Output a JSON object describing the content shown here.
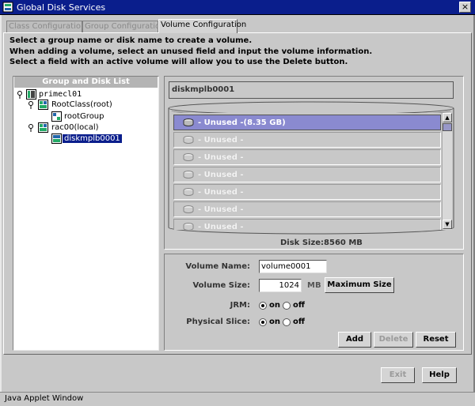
{
  "window": {
    "title": "Global Disk Services",
    "close": "×"
  },
  "tabs": [
    {
      "label": "Class Configuration",
      "active": false
    },
    {
      "label": "Group Configuration",
      "active": false
    },
    {
      "label": "Volume Configuration",
      "active": true
    }
  ],
  "instructions": [
    "Select a group name or disk name to create a volume.",
    "When adding a volume, select an unused field and input the volume information.",
    "Select a field with an active volume will allow you to use the Delete button."
  ],
  "tree": {
    "header": "Group and Disk List",
    "nodes": [
      {
        "label": "primecl01",
        "level": 0
      },
      {
        "label": "RootClass(root)",
        "level": 1
      },
      {
        "label": "rootGroup",
        "level": 2
      },
      {
        "label": "rac00(local)",
        "level": 1
      },
      {
        "label": "diskmplb0001",
        "level": 2,
        "selected": true
      }
    ]
  },
  "disk": {
    "name": "diskmplb0001",
    "size_label": "Disk Size:8560 MB",
    "volumes": [
      {
        "label": "- Unused -(8.35 GB)",
        "selected": true
      },
      {
        "label": "- Unused -",
        "selected": false
      },
      {
        "label": "- Unused -",
        "selected": false
      },
      {
        "label": "- Unused -",
        "selected": false
      },
      {
        "label": "- Unused -",
        "selected": false
      },
      {
        "label": "- Unused -",
        "selected": false
      },
      {
        "label": "- Unused -",
        "selected": false
      }
    ]
  },
  "form": {
    "volume_name_label": "Volume Name:",
    "volume_name_value": "volume0001",
    "volume_size_label": "Volume Size:",
    "volume_size_value": "1024",
    "unit": "MB",
    "max_size_button": "Maximum Size",
    "jrm_label": "JRM:",
    "physical_slice_label": "Physical Slice:",
    "on_label": "on",
    "off_label": "off",
    "jrm": "on",
    "physical_slice": "on",
    "add_button": "Add",
    "delete_button": "Delete",
    "reset_button": "Reset"
  },
  "footer": {
    "exit_button": "Exit",
    "help_button": "Help"
  },
  "status": "Java Applet Window",
  "colors": {
    "titlebar": "#0a1e8c",
    "selected_row": "#8a8ad0",
    "background": "#c8c8c8"
  }
}
